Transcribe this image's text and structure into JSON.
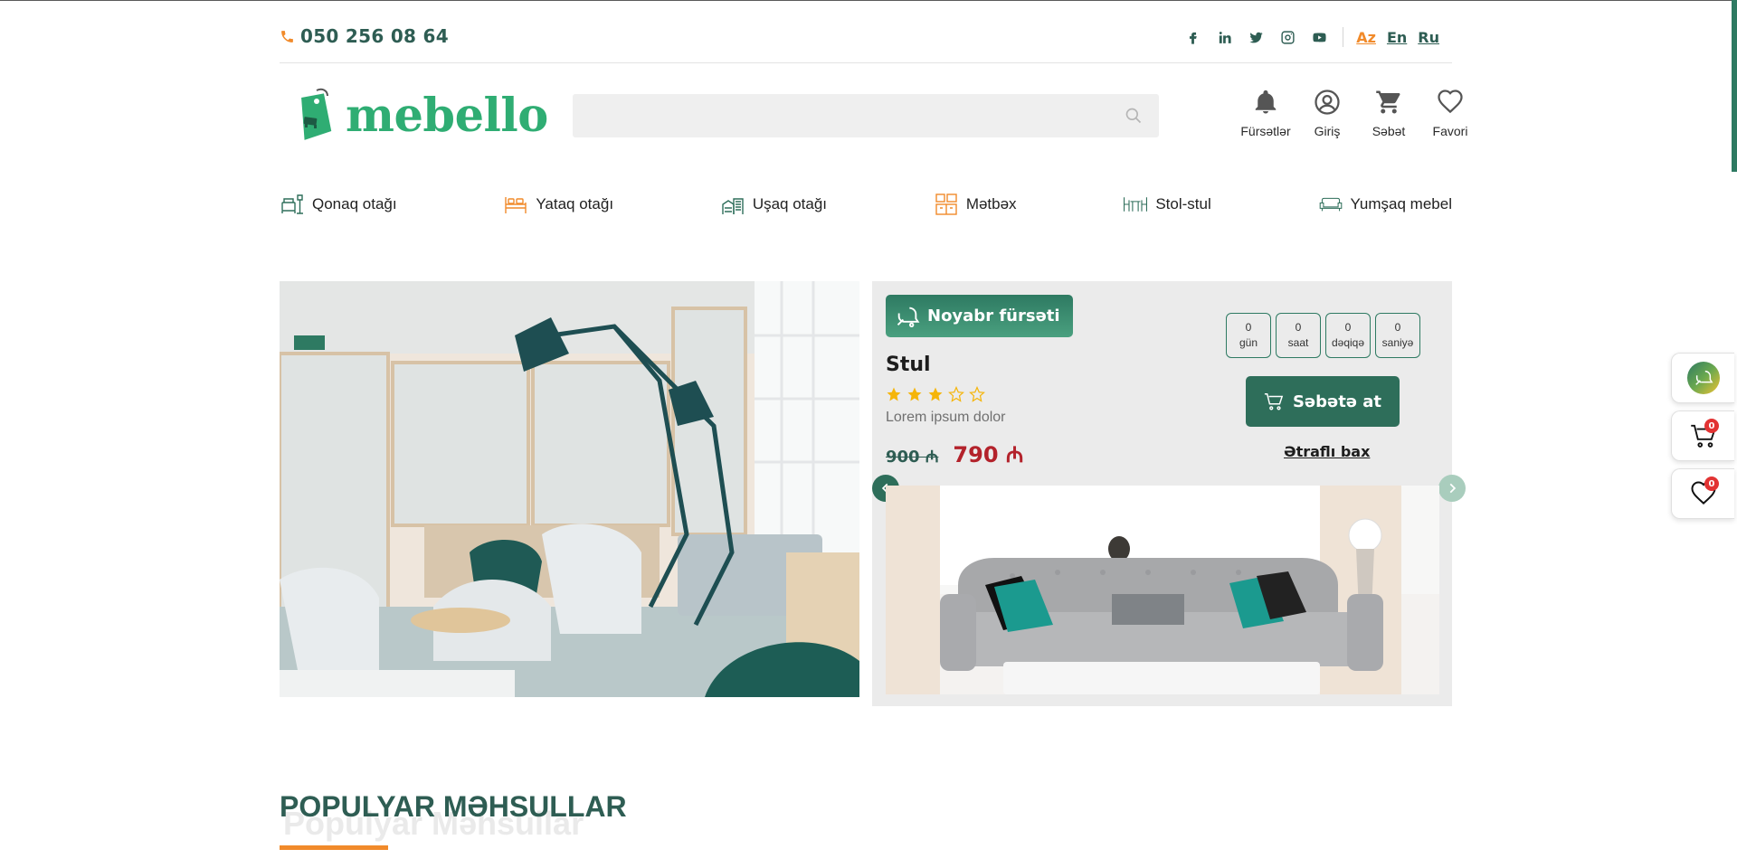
{
  "topbar": {
    "phone": "050 256 08 64",
    "social": [
      "facebook-icon",
      "linkedin-icon",
      "twitter-icon",
      "instagram-icon",
      "youtube-icon"
    ],
    "languages": [
      {
        "label": "Az",
        "active": true
      },
      {
        "label": "En",
        "active": false
      },
      {
        "label": "Ru",
        "active": false
      }
    ]
  },
  "header": {
    "logo_text": "mebello",
    "search_placeholder": "",
    "actions": [
      {
        "icon": "bell-icon",
        "label": "Fürsətlər"
      },
      {
        "icon": "user-icon",
        "label": "Giriş"
      },
      {
        "icon": "cart-icon",
        "label": "Səbət"
      },
      {
        "icon": "heart-icon",
        "label": "Favori"
      }
    ]
  },
  "categories": [
    {
      "icon": "living-room-icon",
      "label": "Qonaq otağı"
    },
    {
      "icon": "bed-icon",
      "label": "Yataq otağı"
    },
    {
      "icon": "kids-room-icon",
      "label": "Uşaq otağı"
    },
    {
      "icon": "kitchen-icon",
      "label": "Mətbəx"
    },
    {
      "icon": "table-chair-icon",
      "label": "Stol-stul"
    },
    {
      "icon": "sofa-icon",
      "label": "Yumşaq mebel"
    }
  ],
  "deal": {
    "badge": "Noyabr fürsəti",
    "product_name": "Stul",
    "rating": 3,
    "rating_max": 5,
    "description": "Lorem ipsum dolor",
    "old_price": "900 ₼",
    "new_price": "790 ₼",
    "timer": [
      {
        "value": "0",
        "unit": "gün"
      },
      {
        "value": "0",
        "unit": "saat"
      },
      {
        "value": "0",
        "unit": "dəqiqə"
      },
      {
        "value": "0",
        "unit": "saniyə"
      }
    ],
    "cart_button": "Səbətə at",
    "more_link": "Ətraflı bax"
  },
  "floating": {
    "cart_count": "0",
    "favorites_count": "0"
  },
  "section": {
    "title": "POPULYAR MƏHSULLAR",
    "ghost_title": "Populyar Məhsullar"
  },
  "colors": {
    "primary": "#2e6e5a",
    "accent": "#f18a2a",
    "price_red": "#b3222b",
    "logo_green": "#2fad73"
  }
}
